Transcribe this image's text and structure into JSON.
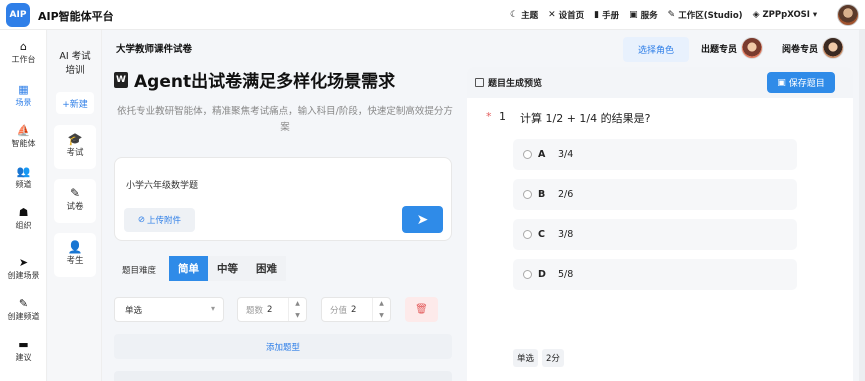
{
  "app": {
    "logo_text": "AIP",
    "title": "AIP智能体平台"
  },
  "top_menu": [
    {
      "icon": "moon-icon",
      "glyph": "☾",
      "label": "主题"
    },
    {
      "icon": "settings-icon",
      "glyph": "✕",
      "label": "设首页"
    },
    {
      "icon": "book-icon",
      "glyph": "▮",
      "label": "手册"
    },
    {
      "icon": "service-icon",
      "glyph": "▣",
      "label": "服务"
    },
    {
      "icon": "pencil-icon",
      "glyph": "✎",
      "label": "工作区(Studio)"
    },
    {
      "icon": "shield-icon",
      "glyph": "◈",
      "label": "ZPPpXOSI ▾"
    }
  ],
  "rail": [
    {
      "glyph": "⌂",
      "label": "工作台"
    },
    {
      "glyph": "▦",
      "label": "场景"
    },
    {
      "glyph": "⛵",
      "label": "智能体"
    },
    {
      "glyph": "👥",
      "label": "频道"
    },
    {
      "glyph": "☗",
      "label": "组织"
    },
    {
      "glyph": "➤",
      "label": "创建场景"
    },
    {
      "glyph": "✎",
      "label": "创建频道"
    },
    {
      "glyph": "▬",
      "label": "建议"
    }
  ],
  "subnav": {
    "title_line1": "AI 考试",
    "title_line2": "培训",
    "new_label": "+新建",
    "items": [
      {
        "glyph": "🎓",
        "label": "考试"
      },
      {
        "glyph": "✎",
        "label": "试卷"
      },
      {
        "glyph": "👤",
        "label": "考生"
      }
    ]
  },
  "main": {
    "page_title": "大学教师课件试卷",
    "hero_icon": "W",
    "hero_title": "Agent出试卷满足多样化场景需求",
    "hero_sub": "依托专业教研智能体，精准聚焦考试痛点，输入科目/阶段，快速定制高效提分方案",
    "input_value": "小学六年级数学题",
    "upload_label": "上传附件",
    "difficulty_label": "题目难度",
    "difficulty_options": [
      "简单",
      "中等",
      "困难"
    ],
    "difficulty_selected": "简单",
    "type_select": "单选",
    "count_label": "题数",
    "count_value": "2",
    "score_label": "分值",
    "score_value": "2",
    "add_label": "添加题型"
  },
  "roles": {
    "select_label": "选择角色",
    "author_label": "出题专员",
    "reviewer_label": "阅卷专员"
  },
  "preview": {
    "title": "题目生成预览",
    "save_label": "保存题目",
    "question_no": "1",
    "question_text": "计算 1/2 + 1/4 的结果是?",
    "options": [
      {
        "letter": "A",
        "text": "3/4"
      },
      {
        "letter": "B",
        "text": "2/6"
      },
      {
        "letter": "C",
        "text": "3/8"
      },
      {
        "letter": "D",
        "text": "5/8"
      }
    ],
    "meta_type": "单选",
    "meta_score": "2分"
  }
}
